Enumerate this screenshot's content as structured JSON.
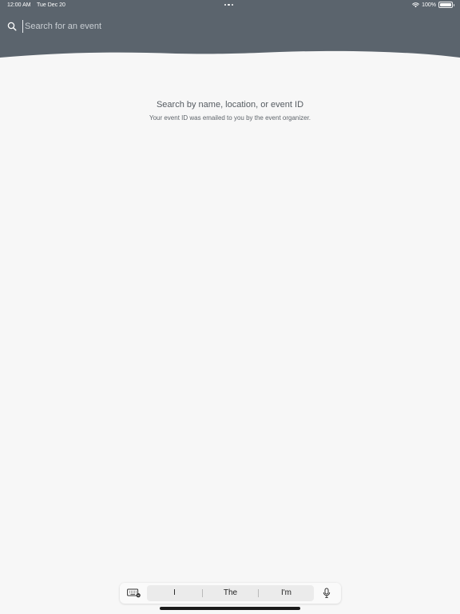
{
  "status_bar": {
    "time": "12:00 AM",
    "date": "Tue Dec 20",
    "battery": "100%",
    "battery_level": 1.0
  },
  "search": {
    "value": "",
    "placeholder": "Search for an event"
  },
  "empty_state": {
    "title": "Search by name, location, or event ID",
    "subtitle": "Your event ID was emailed to you by the event organizer."
  },
  "shortcut_bar": {
    "suggestions": [
      "I",
      "The",
      "I'm"
    ]
  },
  "colors": {
    "header": "#5b646d",
    "background": "#f7f7f7"
  },
  "icons": {
    "wifi": "wifi-icon",
    "battery": "battery-icon",
    "search": "search-icon",
    "keyboard": "keyboard-icon",
    "microphone": "microphone-icon",
    "multitask": "multitask-dots-icon"
  }
}
